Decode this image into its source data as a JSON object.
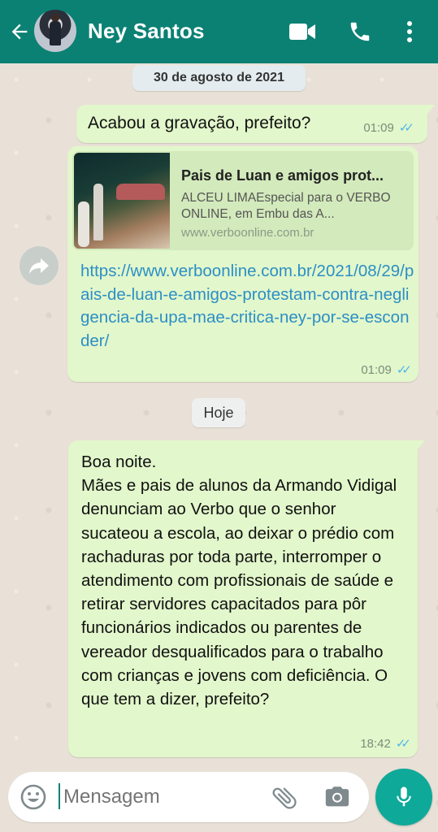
{
  "header": {
    "contact_name": "Ney Santos",
    "icons": [
      "back-arrow-icon",
      "video-call-icon",
      "phone-icon",
      "more-vert-icon"
    ]
  },
  "colors": {
    "header_bg": "#0b8174",
    "bubble_out": "#e2f7cb",
    "link": "#2c8fc6",
    "read_ticks": "#4fb6ec",
    "mic_button": "#0fa99a"
  },
  "chat": {
    "date_chip": "30 de agosto de 2021",
    "today_chip": "Hoje",
    "messages": [
      {
        "text": "Acabou a gravação, prefeito?",
        "time": "01:09",
        "status": "read"
      },
      {
        "preview": {
          "title": "Pais de Luan e amigos prot...",
          "description": "ALCEU LIMAEspecial para o VERBO ONLINE, em Embu das A...",
          "domain": "www.verboonline.com.br"
        },
        "link": "https://www.verboonline.com.br/2021/08/29/pais-de-luan-e-amigos-protestam-contra-negligencia-da-upa-mae-critica-ney-por-se-esconder/",
        "time": "01:09",
        "status": "read"
      },
      {
        "text": "Boa noite.\nMães e pais de alunos da Armando Vidigal denunciam ao Verbo que o senhor sucateou a escola, ao deixar o prédio com rachaduras por toda parte, interromper o atendimento com profissionais de saúde e retirar servidores capacitados para pôr funcionários indicados ou parentes de vereador desqualificados para o trabalho com crianças e jovens com deficiência. O que tem a dizer, prefeito?",
        "time": "18:42",
        "status": "read"
      }
    ]
  },
  "composer": {
    "placeholder": "Mensagem",
    "icons": [
      "emoji-icon",
      "attach-icon",
      "camera-icon",
      "mic-icon"
    ]
  }
}
